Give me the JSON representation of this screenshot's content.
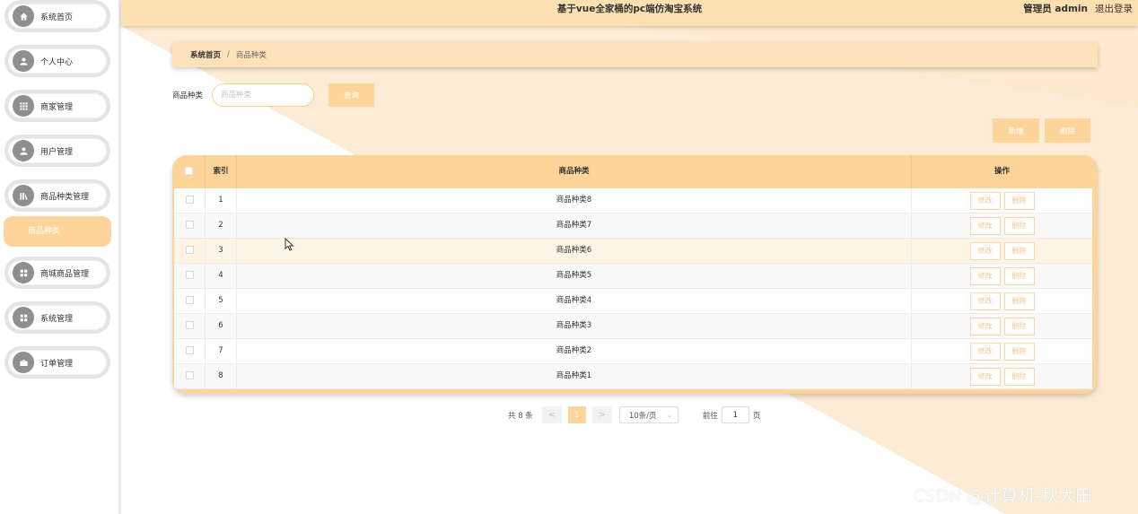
{
  "colors": {
    "accent": "#fdd59b",
    "topbar": "#fde0b1",
    "breadcrumb_bg": "#fde1b8",
    "icon_bg": "#8f8f8f",
    "bg_wedge": "#fdecd5"
  },
  "header": {
    "title": "基于vue全家桶的pc端仿淘宝系统",
    "user": "管理员 admin",
    "logout": "退出登录"
  },
  "sidebar": {
    "items": [
      {
        "label": "系统首页",
        "icon": "home-icon"
      },
      {
        "label": "个人中心",
        "icon": "user-icon"
      },
      {
        "label": "商家管理",
        "icon": "grid-icon"
      },
      {
        "label": "用户管理",
        "icon": "user-icon"
      },
      {
        "label": "商品种类管理",
        "icon": "chart-icon"
      },
      {
        "label": "商城商品管理",
        "icon": "apps-icon"
      },
      {
        "label": "系统管理",
        "icon": "apps-icon"
      },
      {
        "label": "订单管理",
        "icon": "briefcase-icon"
      }
    ],
    "active_sub": "商品种类"
  },
  "breadcrumb": {
    "home": "系统首页",
    "separator": "/",
    "current": "商品种类"
  },
  "search": {
    "label": "商品种类",
    "placeholder": "商品种类",
    "button": "查询"
  },
  "actions": {
    "add": "新增",
    "delete": "删除"
  },
  "table": {
    "headers": [
      "",
      "索引",
      "商品种类",
      "操作"
    ],
    "rows": [
      {
        "index": "1",
        "name": "商品种类8"
      },
      {
        "index": "2",
        "name": "商品种类7"
      },
      {
        "index": "3",
        "name": "商品种类6"
      },
      {
        "index": "4",
        "name": "商品种类5"
      },
      {
        "index": "5",
        "name": "商品种类4"
      },
      {
        "index": "6",
        "name": "商品种类3"
      },
      {
        "index": "7",
        "name": "商品种类2"
      },
      {
        "index": "8",
        "name": "商品种类1"
      }
    ],
    "row_actions": {
      "edit": "修改",
      "delete": "删除"
    }
  },
  "pagination": {
    "total": "共 8 条",
    "prev": "<",
    "current_page": "1",
    "next": ">",
    "page_size": "10条/页",
    "goto_prefix": "前往",
    "goto_value": "1",
    "goto_suffix": "页"
  },
  "watermark": "CSDN @计算机-秋大田"
}
